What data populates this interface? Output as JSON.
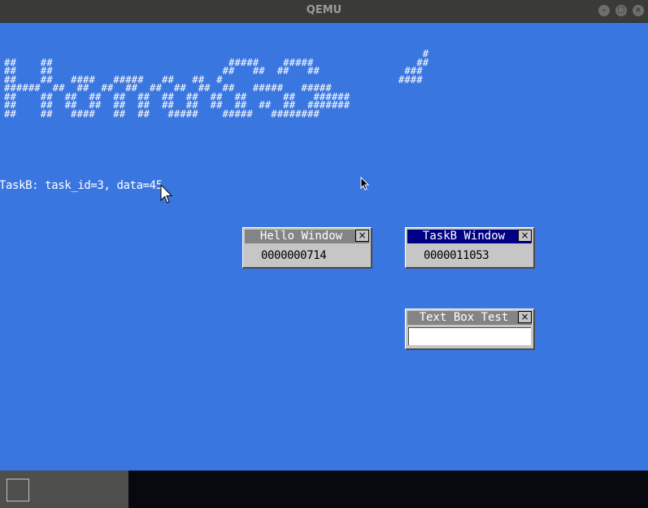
{
  "window": {
    "title": "QEMU",
    "minimize_icon": "–",
    "maximize_icon": "□",
    "close_icon": "×"
  },
  "desktop": {
    "background_color": "#3a76e0",
    "logo_art": "                                                                     #\n##    ##                             #####    #####                 ##\n##    ##                            ##   ##  ##   ##              ###\n##    ##   ####   #####   ##   ##  #                             ####\n######  ##  ##  ##  ##  ##  ##  ##  ##   #####   #####\n##    ##  ##  ##  ##  ##  ##  ##  ##  ##      ##   ######\n##    ##  ##  ##  ##  ##  ##  ##  ##  ##  ##  ##  #######\n##    ##   ####   ##  ##   #####    #####   ########",
    "task_text": "TaskB: task_id=3, data=45"
  },
  "windows": {
    "hello": {
      "title": "Hello Window",
      "value": "0000000714",
      "close_label": "×"
    },
    "taskb": {
      "title": "TaskB Window",
      "value": "0000011053",
      "close_label": "×"
    },
    "textbox": {
      "title": "Text Box Test",
      "close_label": "×",
      "input_value": ""
    }
  },
  "taskbar": {
    "start_icon": "square-icon"
  }
}
